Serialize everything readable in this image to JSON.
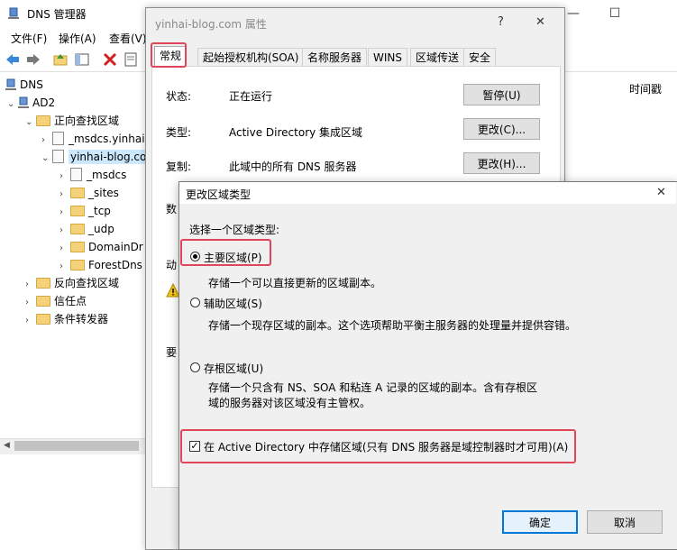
{
  "main": {
    "title": "DNS 管理器",
    "menu": [
      "文件(F)",
      "操作(A)",
      "查看(V)"
    ],
    "window_controls": {
      "minimize": "—",
      "maximize": "☐",
      "close": "✕"
    },
    "column_header": "时间戳",
    "tree": [
      {
        "label": "DNS",
        "level": 0,
        "icon": "server-icon",
        "chevron": ""
      },
      {
        "label": "AD2",
        "level": 1,
        "icon": "server-icon",
        "chevron": "⌄"
      },
      {
        "label": "正向查找区域",
        "level": 2,
        "icon": "folder-icon",
        "chevron": "⌄"
      },
      {
        "label": "_msdcs.yinhai",
        "level": 3,
        "icon": "zone-icon",
        "chevron": "›"
      },
      {
        "label": "yinhai-blog.co",
        "level": 3,
        "icon": "zone-icon",
        "chevron": "⌄",
        "selected": true
      },
      {
        "label": "_msdcs",
        "level": 4,
        "icon": "zone-icon",
        "chevron": "›"
      },
      {
        "label": "_sites",
        "level": 4,
        "icon": "folder-icon",
        "chevron": "›"
      },
      {
        "label": "_tcp",
        "level": 4,
        "icon": "folder-icon",
        "chevron": "›"
      },
      {
        "label": "_udp",
        "level": 4,
        "icon": "folder-icon",
        "chevron": "›"
      },
      {
        "label": "DomainDr",
        "level": 4,
        "icon": "folder-icon",
        "chevron": "›"
      },
      {
        "label": "ForestDns",
        "level": 4,
        "icon": "folder-icon",
        "chevron": "›"
      },
      {
        "label": "反向查找区域",
        "level": 2,
        "icon": "folder-icon",
        "chevron": "›"
      },
      {
        "label": "信任点",
        "level": 2,
        "icon": "folder-icon",
        "chevron": "›"
      },
      {
        "label": "条件转发器",
        "level": 2,
        "icon": "folder-icon",
        "chevron": "›"
      }
    ]
  },
  "props": {
    "title": "yinhai-blog.com 属性",
    "help": "?",
    "close": "✕",
    "tabs": [
      "常规",
      "起始授权机构(SOA)",
      "名称服务器",
      "WINS",
      "区域传送",
      "安全"
    ],
    "rows": [
      {
        "label": "状态:",
        "value": "正在运行",
        "button": "暂停(U)"
      },
      {
        "label": "类型:",
        "value": "Active Directory 集成区域",
        "button": "更改(C)..."
      },
      {
        "label": "复制:",
        "value": "此域中的所有 DNS 服务器",
        "button": "更改(H)..."
      }
    ],
    "partial_labels": [
      "数",
      "动",
      "要"
    ]
  },
  "zone": {
    "title": "更改区域类型",
    "close": "✕",
    "prompt": "选择一个区域类型:",
    "options": [
      {
        "label": "主要区域(P)",
        "selected": true,
        "desc": "存储一个可以直接更新的区域副本。"
      },
      {
        "label": "辅助区域(S)",
        "selected": false,
        "desc": "存储一个现存区域的副本。这个选项帮助平衡主服务器的处理量并提供容错。"
      },
      {
        "label": "存根区域(U)",
        "selected": false,
        "desc_line1": "存储一个只含有 NS、SOA 和粘连 A 记录的区域的副本。含有存根区",
        "desc_line2": "域的服务器对该区域没有主管权。"
      }
    ],
    "ad_checkbox": {
      "label": "在 Active Directory 中存储区域(只有 DNS 服务器是域控制器时才可用)(A)",
      "checked": true,
      "mark": "✓"
    },
    "ok": "确定",
    "cancel": "取消"
  },
  "colors": {
    "highlight": "#e0455a",
    "selection": "#cce8ff"
  }
}
